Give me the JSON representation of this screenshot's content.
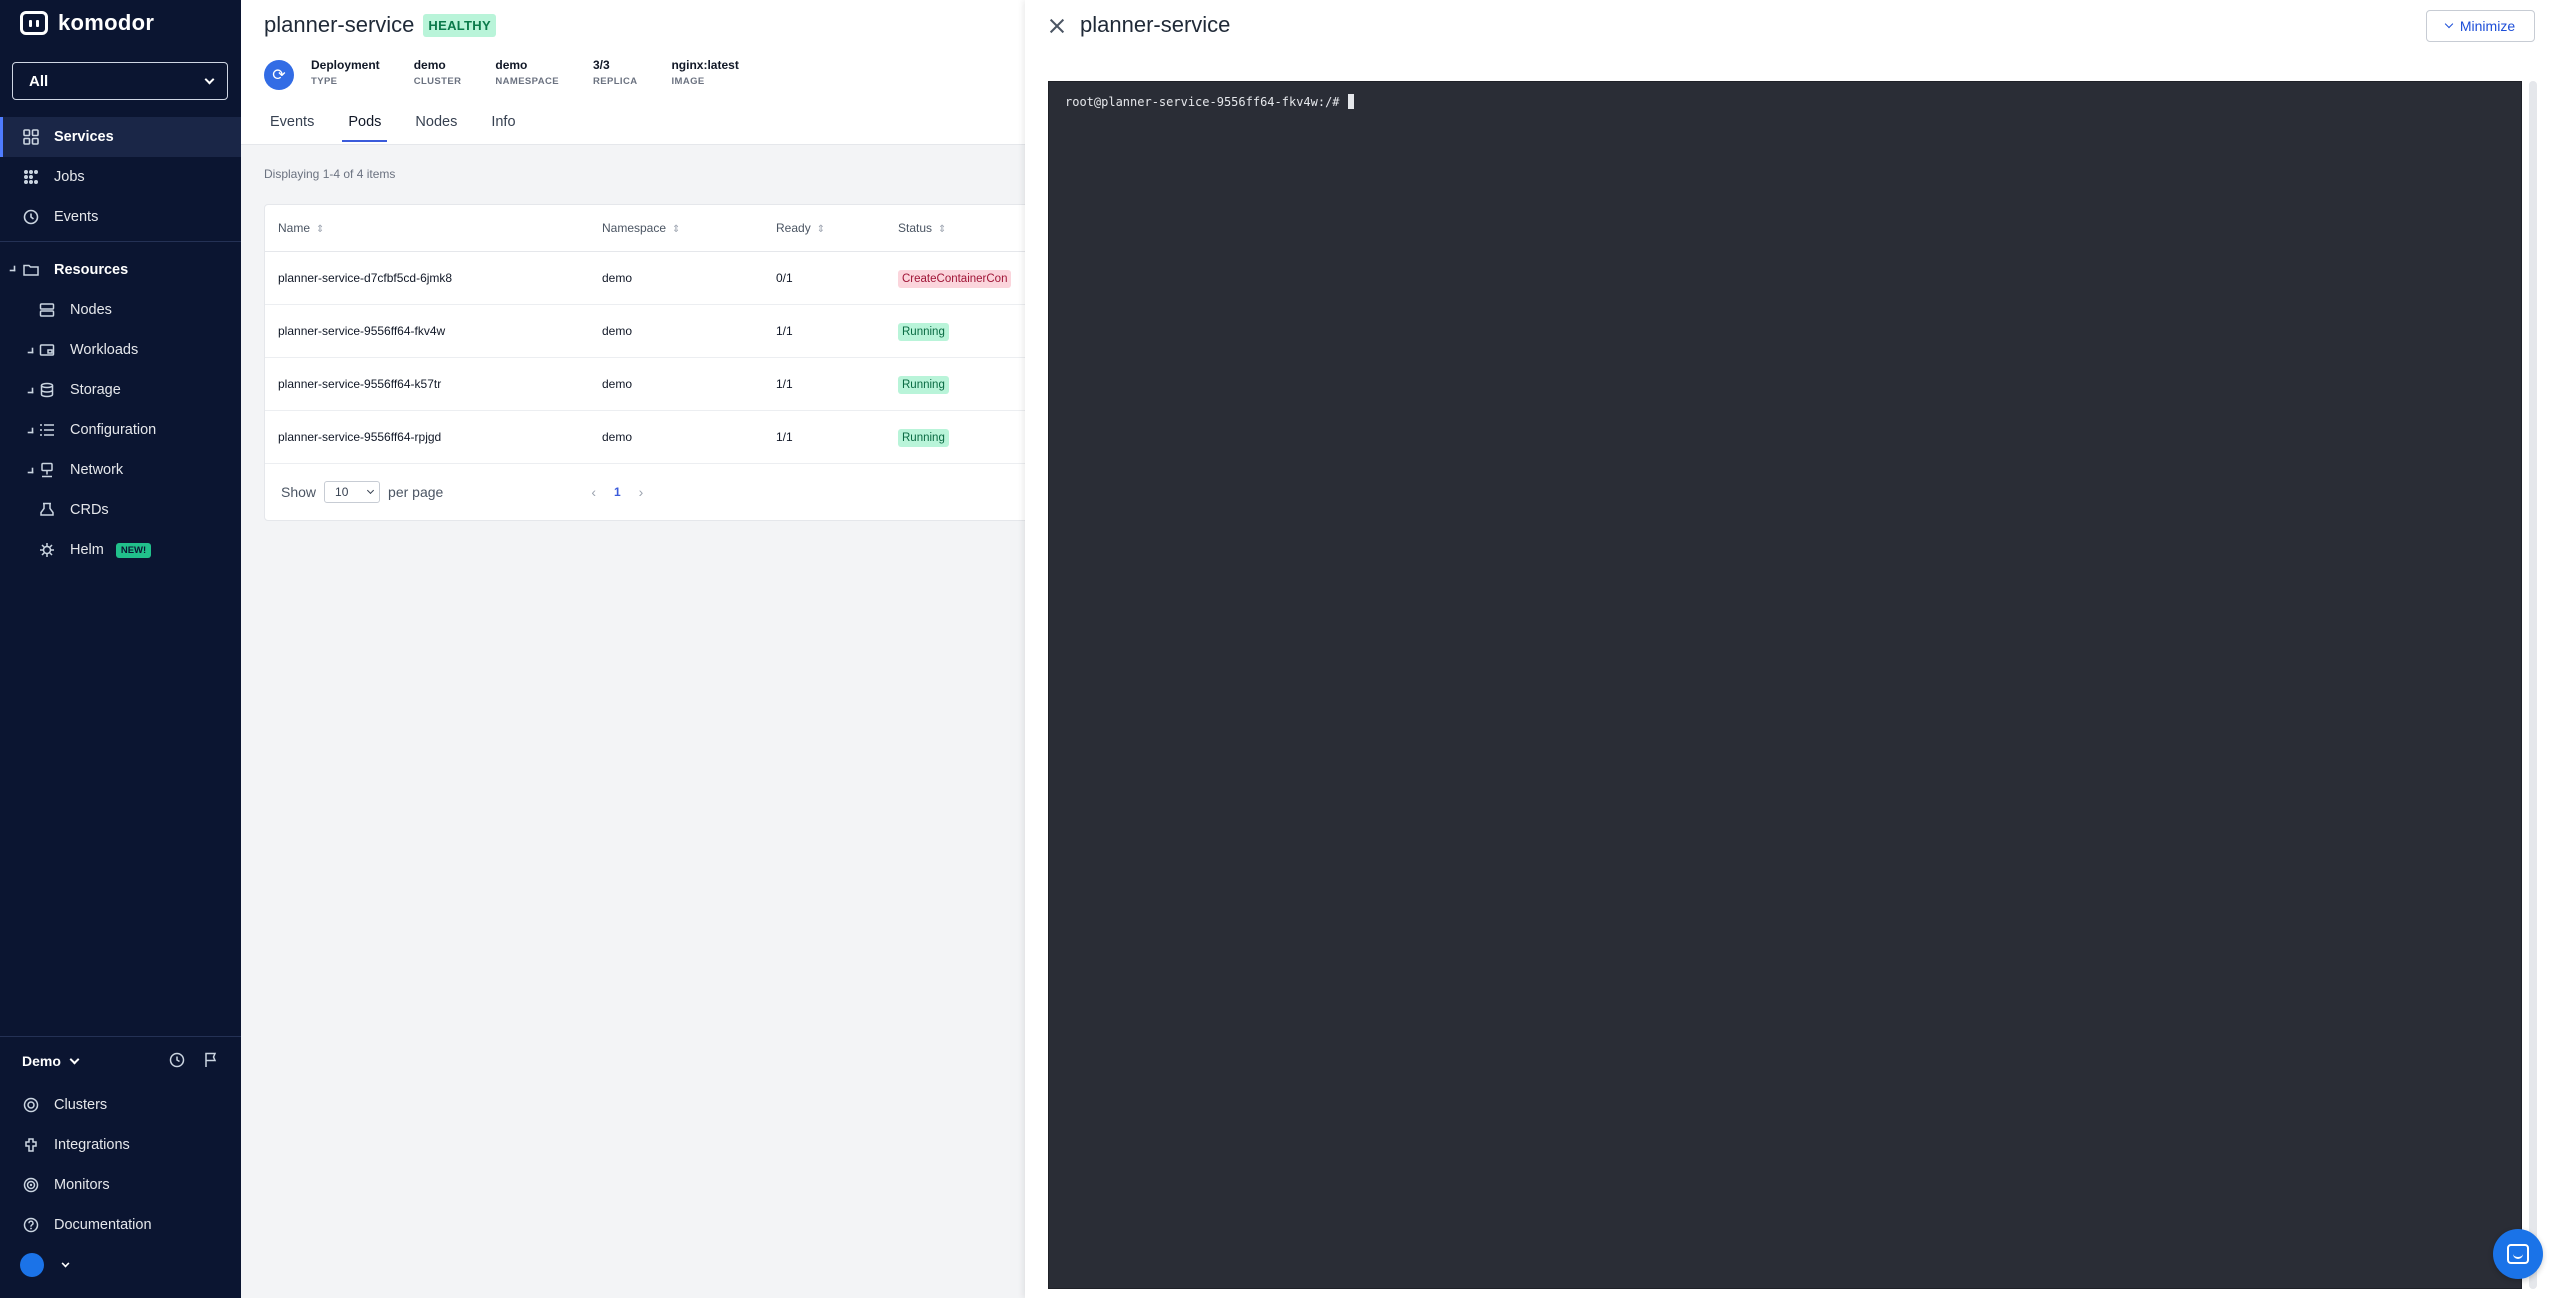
{
  "app": {
    "logo_text": "komodor"
  },
  "sidebar": {
    "cluster_select": "All",
    "items": [
      {
        "label": "Services",
        "icon": "grid-icon"
      },
      {
        "label": "Jobs",
        "icon": "jobs-icon"
      },
      {
        "label": "Events",
        "icon": "clock-icon"
      }
    ],
    "resources": {
      "label": "Resources",
      "items": [
        {
          "label": "Nodes"
        },
        {
          "label": "Workloads"
        },
        {
          "label": "Storage"
        },
        {
          "label": "Configuration"
        },
        {
          "label": "Network"
        },
        {
          "label": "CRDs"
        },
        {
          "label": "Helm",
          "badge": "NEW!"
        }
      ]
    },
    "account": "Demo",
    "bottom_items": [
      {
        "label": "Clusters"
      },
      {
        "label": "Integrations"
      },
      {
        "label": "Monitors"
      },
      {
        "label": "Documentation"
      }
    ]
  },
  "service": {
    "name": "planner-service",
    "health": "HEALTHY",
    "meta": [
      {
        "value": "Deployment",
        "label": "TYPE"
      },
      {
        "value": "demo",
        "label": "CLUSTER"
      },
      {
        "value": "demo",
        "label": "NAMESPACE"
      },
      {
        "value": "3/3",
        "label": "REPLICA"
      },
      {
        "value": "nginx:latest",
        "label": "IMAGE"
      }
    ],
    "tabs": [
      "Events",
      "Pods",
      "Nodes",
      "Info"
    ],
    "active_tab": "Pods"
  },
  "pods_table": {
    "displaying": "Displaying 1-4 of 4 items",
    "columns": [
      "Name",
      "Namespace",
      "Ready",
      "Status"
    ],
    "rows": [
      {
        "name": "planner-service-d7cfbf5cd-6jmk8",
        "namespace": "demo",
        "ready": "0/1",
        "status": "CreateContainerCon"
      },
      {
        "name": "planner-service-9556ff64-fkv4w",
        "namespace": "demo",
        "ready": "1/1",
        "status": "Running"
      },
      {
        "name": "planner-service-9556ff64-k57tr",
        "namespace": "demo",
        "ready": "1/1",
        "status": "Running"
      },
      {
        "name": "planner-service-9556ff64-rpjgd",
        "namespace": "demo",
        "ready": "1/1",
        "status": "Running"
      }
    ],
    "show_label": "Show",
    "per_page_value": "10",
    "per_page_label": "per page",
    "current_page": "1"
  },
  "drawer": {
    "title": "planner-service",
    "minimize_label": "Minimize",
    "terminal_prompt": "root@planner-service-9556ff64-fkv4w:/#"
  },
  "colors": {
    "sidebar_bg": "#0b1531",
    "accent": "#3b5bdb",
    "healthy": "#b9f4d9",
    "error": "#fbd5dc",
    "terminal_bg": "#2a2d36"
  }
}
